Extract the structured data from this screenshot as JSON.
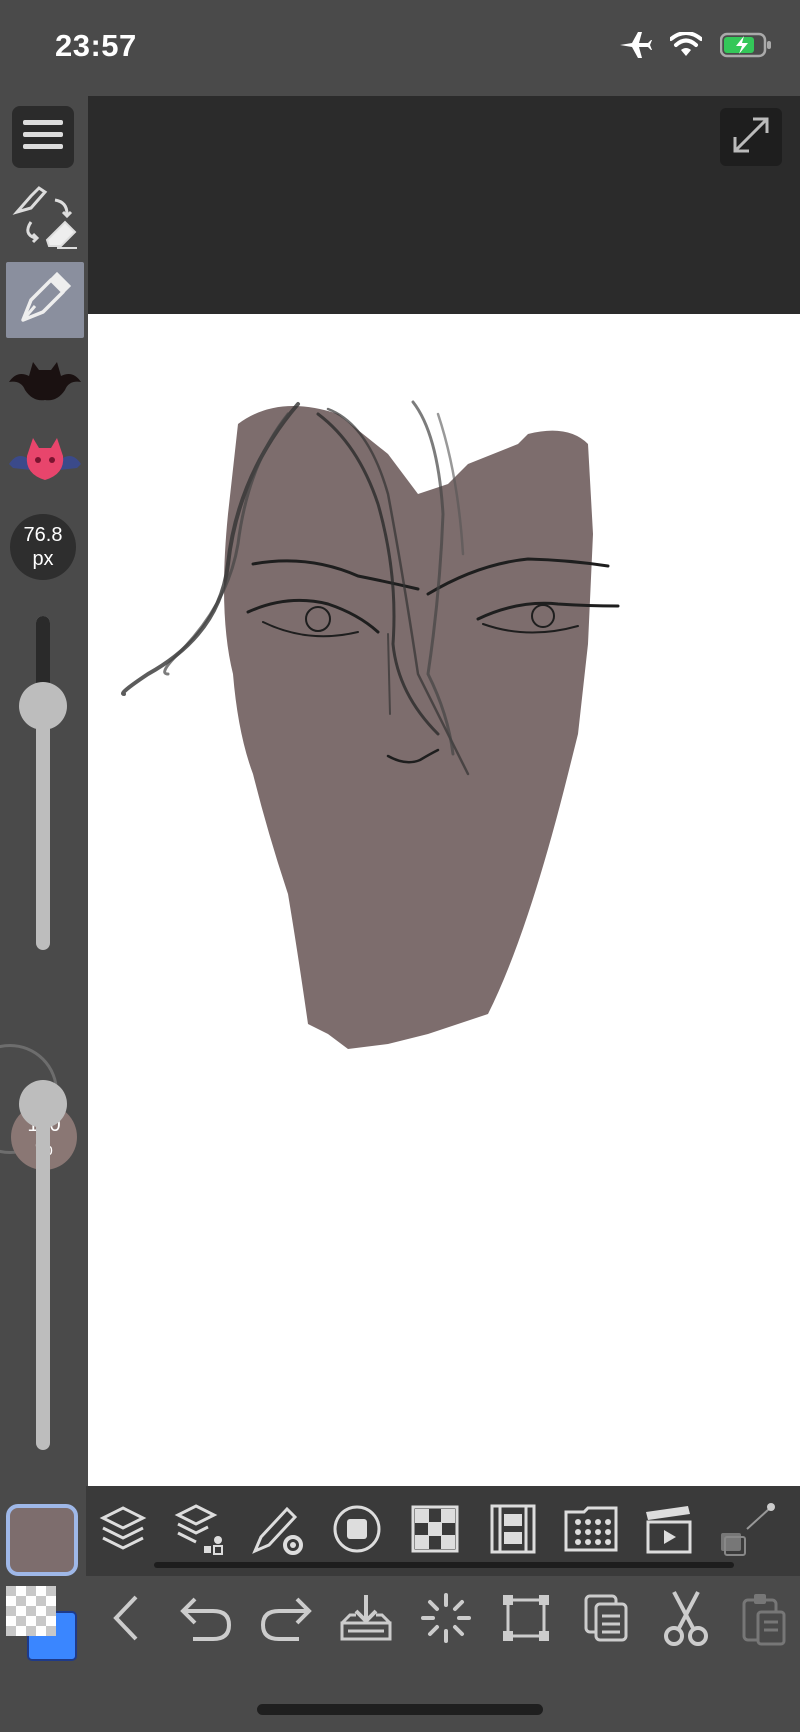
{
  "status_bar": {
    "time": "23:57",
    "icons": [
      "airplane-icon",
      "wifi-icon",
      "battery-charging-icon"
    ]
  },
  "left_rail": {
    "menu_icon": "hamburger-menu-icon",
    "tools": [
      "pen-eraser-swap-icon",
      "pen-tool-icon",
      "black-bat-brush-icon",
      "pink-bat-brush-icon"
    ],
    "selected_tool": "pen-tool-icon",
    "brush_size": {
      "value": "76.8",
      "unit": "px"
    },
    "brush_size_slider_level": 0.27,
    "opacity": {
      "value": "100",
      "unit": "%"
    },
    "opacity_slider_level": 1.0
  },
  "canvas": {
    "expand_icon": "expand-diagonal-icon",
    "fill_color": "#7d6d6d"
  },
  "current_color": "#7d6d6d",
  "toolbar1": {
    "icons": [
      "layers-icon",
      "layer-properties-icon",
      "brush-settings-icon",
      "color-circle-icon",
      "material-tiles-icon",
      "filmstrip-icon",
      "grid-dots-icon",
      "clapperboard-icon",
      "reference-icon"
    ]
  },
  "toolbar2": {
    "icons": [
      "color-pair-icon",
      "back-icon",
      "undo-icon",
      "redo-icon",
      "save-download-icon",
      "loading-spinner-icon",
      "transform-icon",
      "copy-icon",
      "cut-icon",
      "paste-icon"
    ]
  },
  "colors": {
    "background": "#4a4a4a",
    "canvas_surround": "#2b2b2b",
    "selection": "#8a8f9e",
    "accent": "#3a86ff"
  }
}
